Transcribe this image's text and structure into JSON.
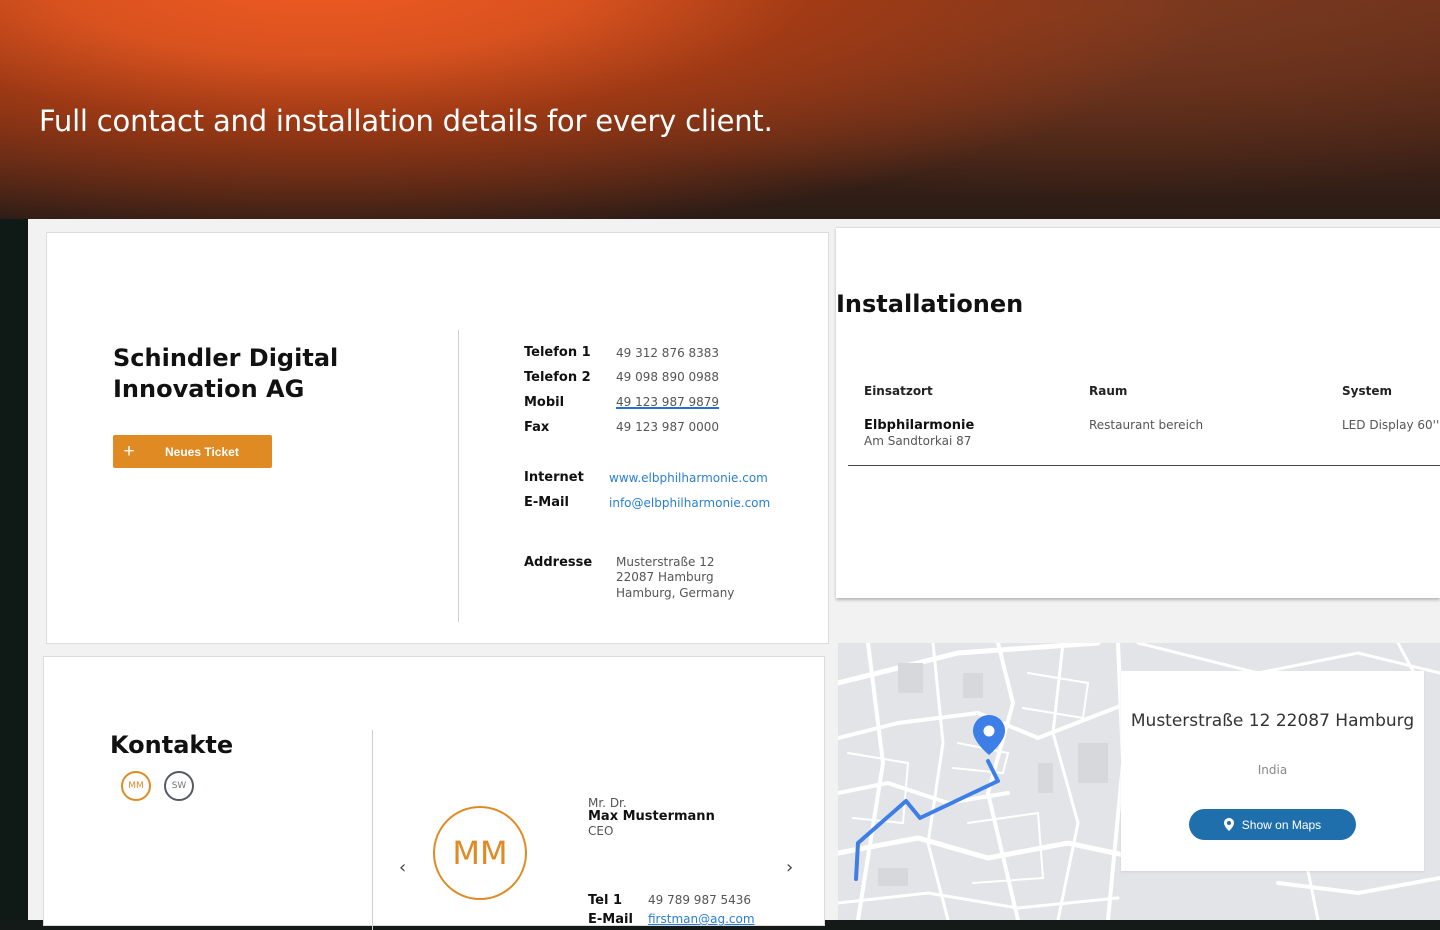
{
  "hero": {
    "title": "Full contact and installation details for every client."
  },
  "company": {
    "name_line1": "Schindler Digital",
    "name_line2": "Innovation AG",
    "new_ticket_label": "Neues Ticket",
    "phones": [
      {
        "label": "Telefon 1",
        "value": "49 312 876 8383"
      },
      {
        "label": "Telefon 2",
        "value": "49 098 890 0988"
      },
      {
        "label": "Mobil",
        "value": "49 123 987 9879"
      },
      {
        "label": "Fax",
        "value": "49 123 987 0000"
      }
    ],
    "internet": {
      "label": "Internet",
      "value": "www.elbphilharmonie.com"
    },
    "email": {
      "label": "E-Mail",
      "value": "info@elbphilharmonie.com"
    },
    "address": {
      "label": "Addresse",
      "line1": "Musterstraße 12",
      "line2": "22087 Hamburg",
      "line3": "Hamburg, Germany"
    }
  },
  "installations": {
    "title": "Installationen",
    "headers": {
      "location": "Einsatzort",
      "room": "Raum",
      "system": "System"
    },
    "rows": [
      {
        "name": "Elbphilarmonie",
        "address": "Am Sandtorkai 87",
        "room": "Restaurant bereich",
        "system": "LED Display 60''"
      }
    ]
  },
  "contacts": {
    "title": "Kontakte",
    "chips": [
      "MM",
      "SW"
    ],
    "selected": {
      "initials": "MM",
      "salutation": "Mr. Dr.",
      "name": "Max Mustermann",
      "role": "CEO",
      "tel1_label": "Tel 1",
      "tel1_value": "49 789 987 5436",
      "email_label": "E-Mail",
      "email_value": "firstman@ag.com"
    },
    "prev_icon": "‹",
    "next_icon": "›"
  },
  "map": {
    "address": "Musterstraße 12 22087 Hamburg",
    "country": "India",
    "button_label": "Show on Maps",
    "route_color": "#3d7fe6",
    "pin_color": "#3d7fe6"
  },
  "colors": {
    "accent": "#e08a24",
    "link": "#2a7fd4",
    "maps_button": "#1f6fad"
  }
}
